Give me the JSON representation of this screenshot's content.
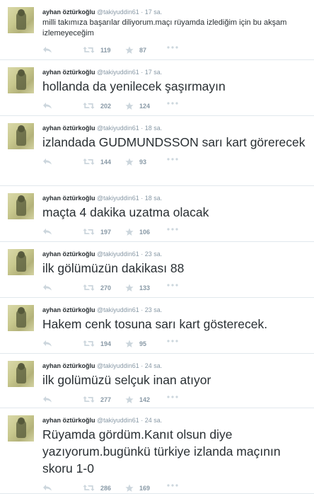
{
  "tweets": [
    {
      "name": "ayhan öztürkoğlu",
      "handle": "@takiyuddin61",
      "separator": "·",
      "time": "17 sa.",
      "text": "milli takımıza başarılar diliyorum.maçı rüyamda izlediğim için bu akşam izlemeyeceğim",
      "retweets": "119",
      "favorites": "87"
    },
    {
      "name": "ayhan öztürkoğlu",
      "handle": "@takiyuddin61",
      "separator": "·",
      "time": "17 sa.",
      "text": "hollanda da yenilecek şaşırmayın",
      "retweets": "202",
      "favorites": "124"
    },
    {
      "name": "ayhan öztürkoğlu",
      "handle": "@takiyuddin61",
      "separator": "·",
      "time": "18 sa.",
      "text": "izlandada GUDMUNDSSON sarı kart görerecek",
      "retweets": "144",
      "favorites": "93"
    },
    {
      "name": "ayhan öztürkoğlu",
      "handle": "@takiyuddin61",
      "separator": "·",
      "time": "18 sa.",
      "text": "maçta 4 dakika uzatma olacak",
      "retweets": "197",
      "favorites": "106"
    },
    {
      "name": "ayhan öztürkoğlu",
      "handle": "@takiyuddin61",
      "separator": "·",
      "time": "23 sa.",
      "text": "ilk gölümüzün dakikası 88",
      "retweets": "270",
      "favorites": "133"
    },
    {
      "name": "ayhan öztürkoğlu",
      "handle": "@takiyuddin61",
      "separator": "·",
      "time": "23 sa.",
      "text": "Hakem cenk tosuna sarı kart gösterecek.",
      "retweets": "194",
      "favorites": "95"
    },
    {
      "name": "ayhan öztürkoğlu",
      "handle": "@takiyuddin61",
      "separator": "·",
      "time": "24 sa.",
      "text": "ilk golümüzü  selçuk inan atıyor",
      "retweets": "277",
      "favorites": "142"
    },
    {
      "name": "ayhan öztürkoğlu",
      "handle": "@takiyuddin61",
      "separator": "·",
      "time": "24 sa.",
      "text": "Rüyamda gördüm.Kanıt olsun diye yazıyorum.bugünkü türkiye izlanda maçının skoru 1-0",
      "retweets": "286",
      "favorites": "169"
    }
  ],
  "icons": {
    "reply": "reply-icon",
    "retweet": "retweet-icon",
    "favorite": "star-icon",
    "more": "more-icon"
  },
  "colors": {
    "name": "#292f33",
    "meta": "#8899a6",
    "icon": "#ccd6dd",
    "divider": "#e1e8ed"
  }
}
